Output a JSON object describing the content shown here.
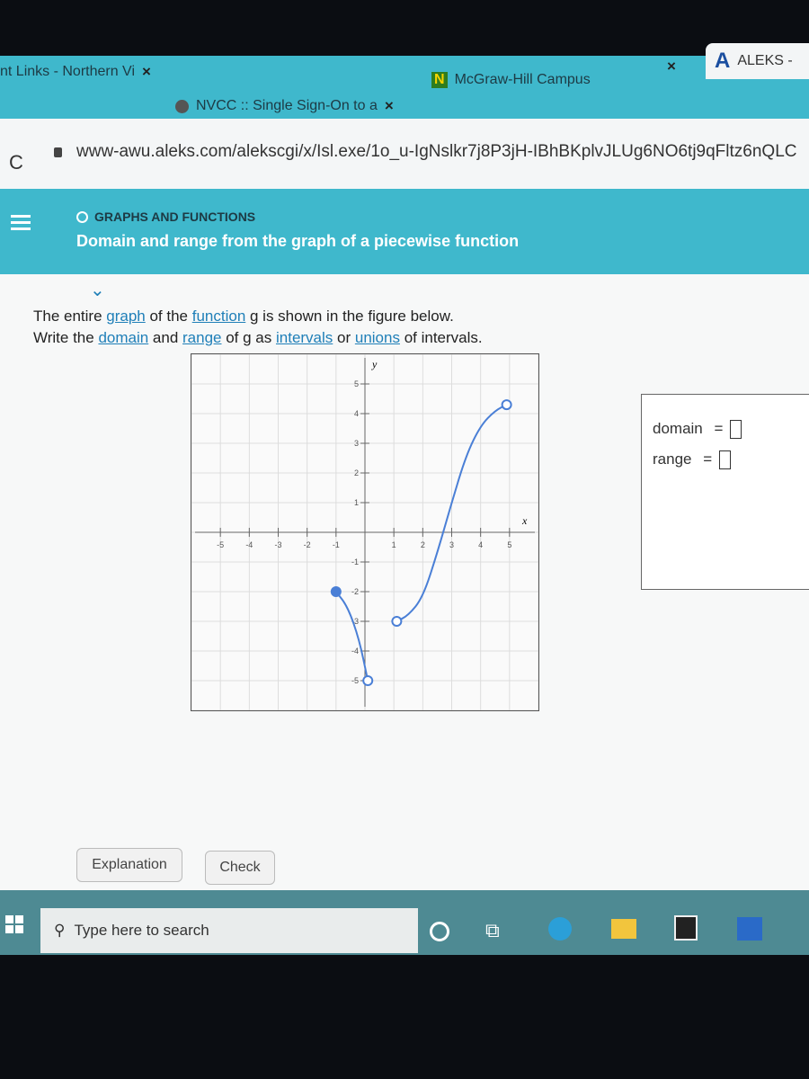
{
  "browser": {
    "tabs": [
      {
        "label": "nt Links - Northern Vi",
        "close": "×"
      },
      {
        "label": "NVCC :: Single Sign-On to a",
        "close": "×",
        "icon": "globe-icon"
      },
      {
        "label": "McGraw-Hill Campus",
        "close": "×",
        "icon": "mcgraw-hill-n-icon"
      },
      {
        "label": "ALEKS -",
        "icon": "aleks-a-icon",
        "active": true
      }
    ],
    "url": "www-awu.aleks.com/alekscgi/x/Isl.exe/1o_u-IgNslkr7j8P3jH-IBhBKplvJLUg6NO6tj9qFltz6nQLC",
    "reload_icon": "C"
  },
  "header": {
    "topic": "GRAPHS AND FUNCTIONS",
    "title": "Domain and range from the graph of a piecewise function"
  },
  "question": {
    "line1": [
      "The entire ",
      "graph",
      " of the ",
      "function",
      " g is shown in the figure below."
    ],
    "line2": [
      "Write the ",
      "domain",
      " and ",
      "range",
      " of g as ",
      "intervals",
      " or ",
      "unions",
      " of intervals."
    ]
  },
  "answer": {
    "domain_label": "domain",
    "range_label": "range",
    "equals": "=",
    "domain_value": "",
    "range_value": ""
  },
  "buttons": {
    "explanation": "Explanation",
    "check": "Check"
  },
  "taskbar": {
    "search_placeholder": "Type here to search"
  },
  "chart_data": {
    "type": "line",
    "xlabel": "x",
    "ylabel": "y",
    "xlim": [
      -6,
      6
    ],
    "ylim": [
      -6,
      6
    ],
    "x_ticks": [
      -5,
      -4,
      -3,
      -2,
      -1,
      1,
      2,
      3,
      4,
      5
    ],
    "y_ticks": [
      -5,
      -4,
      -3,
      -2,
      -1,
      1,
      2,
      3,
      4,
      5
    ],
    "grid": true,
    "color": "#4a7fd6",
    "segments": [
      {
        "points": [
          [
            -1,
            -2
          ],
          [
            -0.6,
            -2.5
          ],
          [
            -0.2,
            -3.6
          ],
          [
            0.1,
            -5
          ]
        ],
        "start": "closed",
        "end": "open"
      },
      {
        "points": [
          [
            1.1,
            -3
          ],
          [
            1.5,
            -2.8
          ],
          [
            2,
            -2.2
          ],
          [
            2.5,
            -0.7
          ],
          [
            3,
            1
          ],
          [
            3.5,
            2.6
          ],
          [
            4,
            3.6
          ],
          [
            4.5,
            4.1
          ],
          [
            4.9,
            4.3
          ]
        ],
        "start": "open",
        "end": "open"
      }
    ]
  }
}
